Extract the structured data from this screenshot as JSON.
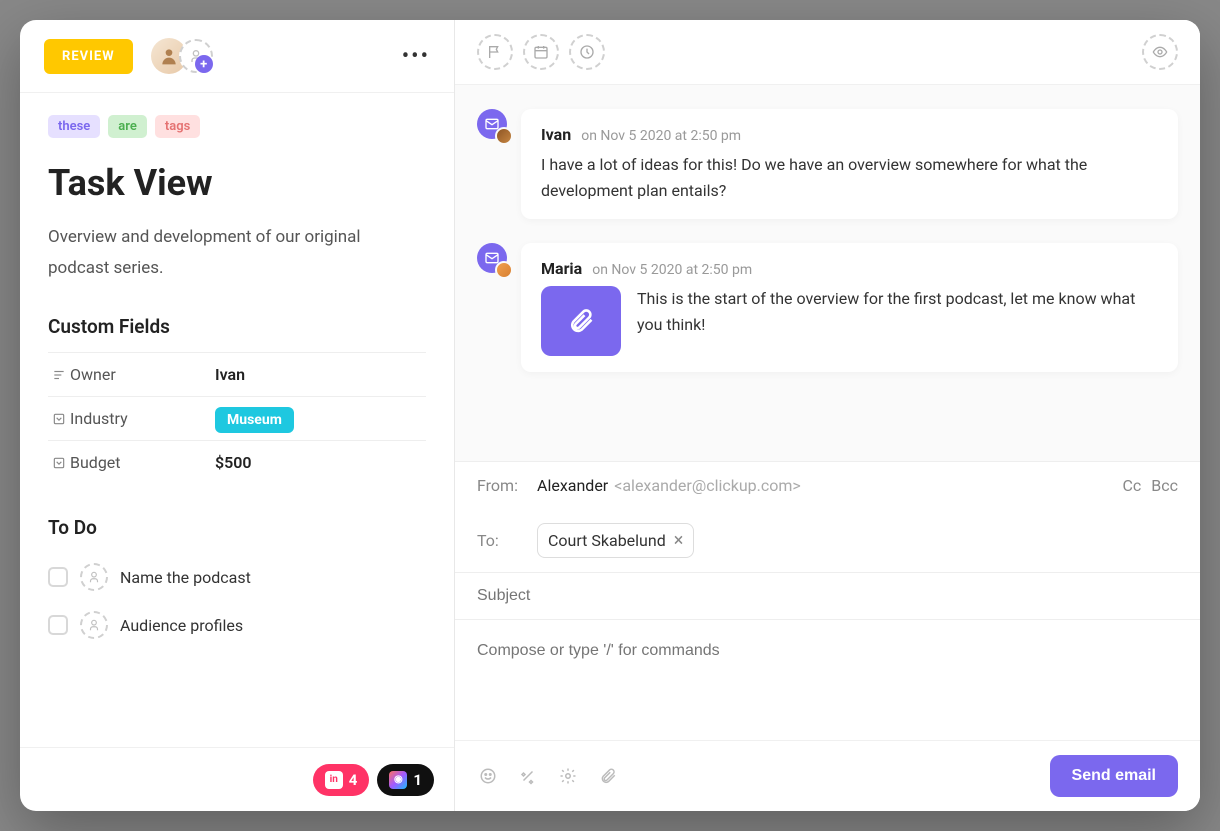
{
  "header": {
    "status_label": "REVIEW"
  },
  "tags": [
    "these",
    "are",
    "tags"
  ],
  "task": {
    "title": "Task View",
    "description": "Overview and development of our original podcast series."
  },
  "custom_fields": {
    "heading": "Custom Fields",
    "rows": [
      {
        "label": "Owner",
        "value": "Ivan",
        "type": "text"
      },
      {
        "label": "Industry",
        "value": "Museum",
        "type": "pill"
      },
      {
        "label": "Budget",
        "value": "$500",
        "type": "text"
      }
    ]
  },
  "todo": {
    "heading": "To Do",
    "items": [
      "Name the podcast",
      "Audience profiles"
    ]
  },
  "attachments": {
    "invision_count": "4",
    "figma_count": "1"
  },
  "messages": [
    {
      "author": "Ivan",
      "meta": "on Nov 5 2020 at 2:50 pm",
      "body": "I have a lot of ideas for this! Do we have an overview somewhere for what the development plan entails?",
      "has_attachment": false
    },
    {
      "author": "Maria",
      "meta": "on Nov 5 2020 at 2:50 pm",
      "body": "This is the start of the overview for the first podcast, let me know what you think!",
      "has_attachment": true
    }
  ],
  "compose": {
    "from_label": "From:",
    "from_name": "Alexander",
    "from_email": "<alexander@clickup.com>",
    "cc_label": "Cc",
    "bcc_label": "Bcc",
    "to_label": "To:",
    "to_recipient": "Court Skabelund",
    "subject_placeholder": "Subject",
    "body_placeholder": "Compose or type '/' for commands",
    "send_label": "Send email"
  }
}
